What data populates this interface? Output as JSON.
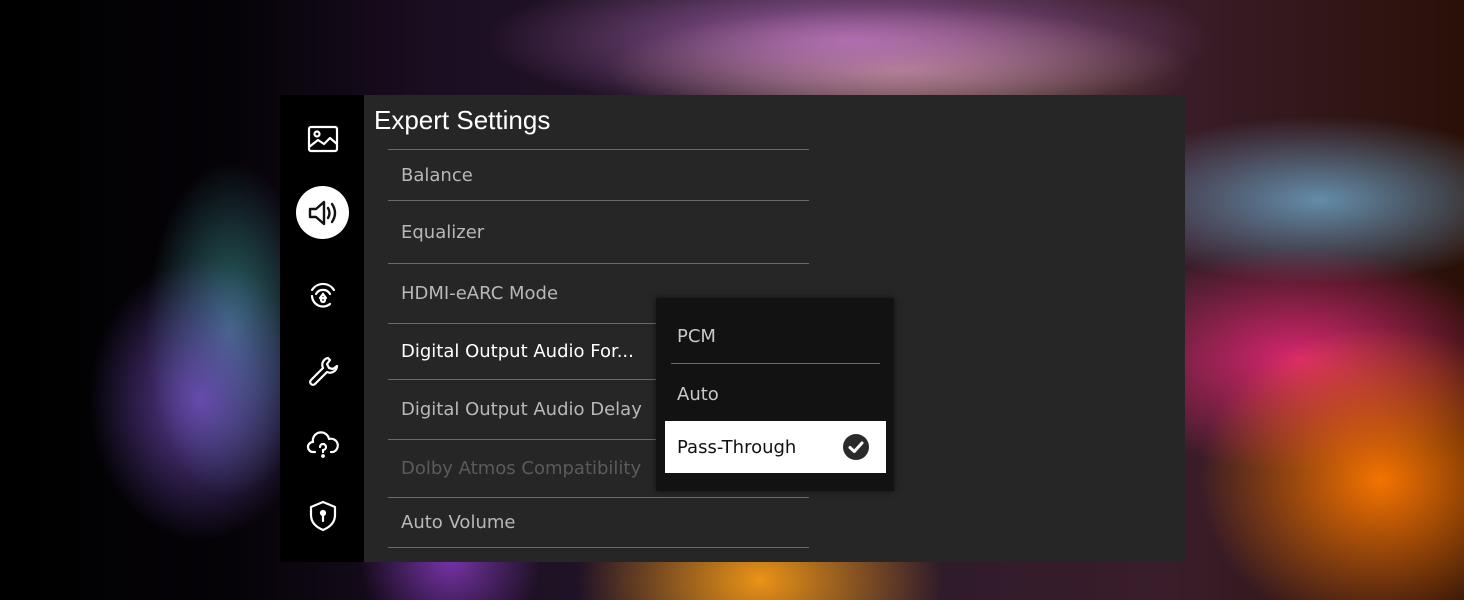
{
  "panel": {
    "title": "Expert Settings"
  },
  "sidebar": {
    "items": [
      {
        "icon": "picture-icon",
        "active": false
      },
      {
        "icon": "speaker-icon",
        "active": true
      },
      {
        "icon": "network-icon",
        "active": false
      },
      {
        "icon": "wrench-icon",
        "active": false
      },
      {
        "icon": "cloud-help-icon",
        "active": false
      },
      {
        "icon": "shield-icon",
        "active": false
      }
    ]
  },
  "settings": {
    "items": [
      {
        "label": "Balance"
      },
      {
        "label": "Equalizer"
      },
      {
        "label": "HDMI-eARC Mode"
      },
      {
        "label": "Digital Output Audio For..."
      },
      {
        "label": "Digital Output Audio Delay"
      },
      {
        "label": "Dolby Atmos Compatibility"
      },
      {
        "label": "Auto Volume"
      }
    ]
  },
  "dropdown": {
    "options": [
      {
        "label": "PCM"
      },
      {
        "label": "Auto"
      },
      {
        "label": "Pass-Through"
      }
    ],
    "selected": "Pass-Through"
  }
}
